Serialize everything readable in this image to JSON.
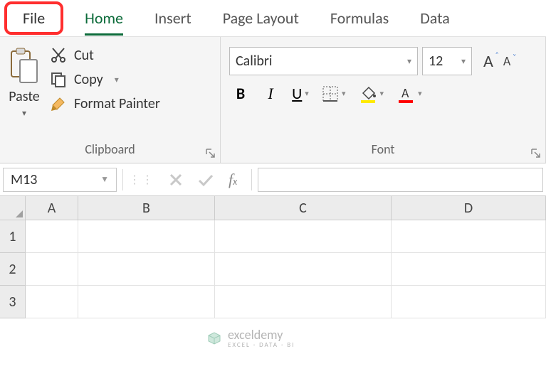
{
  "tabs": {
    "file": "File",
    "home": "Home",
    "insert": "Insert",
    "pagelayout": "Page Layout",
    "formulas": "Formulas",
    "data": "Data"
  },
  "clipboard": {
    "title": "Clipboard",
    "paste": "Paste",
    "cut": "Cut",
    "copy": "Copy",
    "formatPainter": "Format Painter"
  },
  "font": {
    "title": "Font",
    "name": "Calibri",
    "size": "12",
    "bold": "B",
    "italic": "I",
    "underline": "U"
  },
  "nameBox": "M13",
  "columns": [
    "A",
    "B",
    "C",
    "D"
  ],
  "rows": [
    "1",
    "2",
    "3"
  ],
  "watermark": {
    "brand": "exceldemy",
    "tagline": "EXCEL · DATA · BI"
  }
}
